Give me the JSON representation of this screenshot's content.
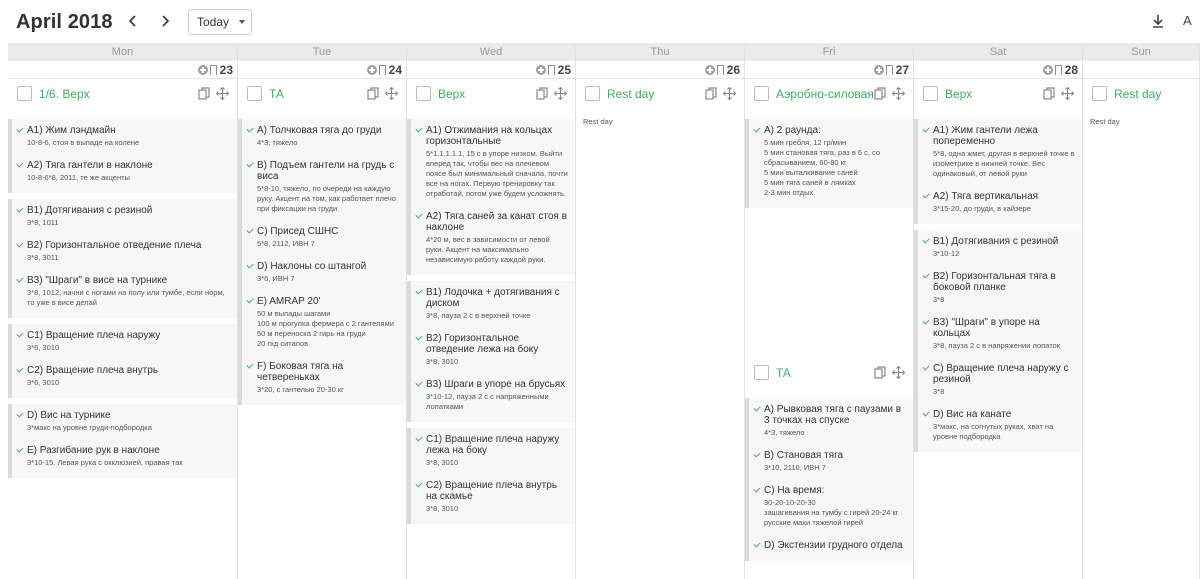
{
  "header": {
    "month_title": "April 2018",
    "today_label": "Today",
    "font_label": "A"
  },
  "days": [
    {
      "name": "Mon",
      "date": "23",
      "workout": {
        "title": "1/6. Верх",
        "blocks": [
          [
            {
              "name": "A1) Жим лэндмайн",
              "desc": "10-8-6, стоя в выпаде на колене"
            },
            {
              "name": "A2) Тяга гантели в наклоне",
              "desc": "10-8-6*8, 2011, те же акценты"
            }
          ],
          [
            {
              "name": "B1) Дотягивания с резиной",
              "desc": "3*8, 1011"
            },
            {
              "name": "B2) Горизонтальное отведение плеча",
              "desc": "3*8, 3011"
            },
            {
              "name": "B3) \"Шраги\" в висе на турнике",
              "desc": "3*8, 1012, начни с ногами на полу или тумбе, если норм, то уже в висе делай"
            }
          ],
          [
            {
              "name": "C1) Вращение плеча наружу",
              "desc": "3*6, 3010"
            },
            {
              "name": "C2) Вращение плеча внутрь",
              "desc": "3*6, 3010"
            }
          ],
          [
            {
              "name": "D) Вис на турнике",
              "desc": "3*макс на уровне груди-подбородка"
            },
            {
              "name": "E) Разгибание рук в наклоне",
              "desc": "3*10-15. Левая рука с окклюзией, правая так"
            }
          ]
        ]
      }
    },
    {
      "name": "Tue",
      "date": "24",
      "workout": {
        "title": "ТА",
        "blocks": [
          [
            {
              "name": "A) Толчковая тяга до груди",
              "desc": "4*3, тяжело"
            },
            {
              "name": "B) Подъем гантели на грудь с виса",
              "desc": "5*8-10, тяжело, по очереди на каждую руку. Акцент на том, как работает плечо при фиксации на груди"
            },
            {
              "name": "C) Присед СШНС",
              "desc": "5*8, 2112, ИВН 7"
            },
            {
              "name": "D) Наклоны со штангой",
              "desc": "3*6, ИВН 7"
            },
            {
              "name": "E) AMRAP 20'",
              "desc": "50 м выпады шагами\n100 м прогулка фермера с 2 гантелями\n50 м переноска 2 гирь на груди\n20 гхд ситапов"
            },
            {
              "name": "F) Боковая тяга на четвереньках",
              "desc": "3*20, с гантелью 20-30 кг"
            }
          ]
        ]
      }
    },
    {
      "name": "Wed",
      "date": "25",
      "workout": {
        "title": "Верх",
        "blocks": [
          [
            {
              "name": "A1) Отжимания на кольцах горизонтальные",
              "desc": "5*1.1.1.1.1, 15 с в упоре низком. Выйти вперед так, чтобы вес на плечевом поясе был минимальный сначала, почти все на ногах. Первую тренировку так отработай, потом уже будем усложнять."
            },
            {
              "name": "A2) Тяга саней за канат стоя в наклоне",
              "desc": "4*20 м, вес в зависимости от левой руки. Акцент на максимально независимую работу каждой руки."
            }
          ],
          [
            {
              "name": "B1) Лодочка + дотягивания с диском",
              "desc": "3*8, пауза 2 с в верхней точке"
            },
            {
              "name": "B2) Горизонтальное отведение лежа на боку",
              "desc": "3*8, 3010"
            },
            {
              "name": "B3) Шраги в упоре на брусьях",
              "desc": "3*10-12, пауза 2 с с напряженными лопатками"
            }
          ],
          [
            {
              "name": "C1) Вращение плеча наружу лежа на боку",
              "desc": "3*8, 3010"
            },
            {
              "name": "C2) Вращение плеча внутрь на скамье",
              "desc": "3*8, 3010"
            }
          ]
        ]
      }
    },
    {
      "name": "Thu",
      "date": "26",
      "workout": {
        "title": "Rest day",
        "rest_text": "Rest day",
        "blocks": []
      }
    },
    {
      "name": "Fri",
      "date": "27",
      "workout": {
        "title": "Аэробно-силовая",
        "blocks": [
          [
            {
              "name": "A) 2 раунда:",
              "desc": "5 мин гребля, 12 гр/мин\n5 мин становая тяга, раз в 6 с, со сбрасыванием, 60-80 кг\n5 мин выталкивание саней\n5 мин тяга саней в лямках\n2-3 мин отдых"
            }
          ]
        ]
      },
      "workout2": {
        "title": "ТА",
        "blocks": [
          [
            {
              "name": "A) Рывковая тяга с паузами в 3 точках на спуске",
              "desc": "4*3, тяжело"
            },
            {
              "name": "B) Становая тяга",
              "desc": "3*10, 2110, ИВН 7"
            },
            {
              "name": "C) На время:",
              "desc": "30-20-10-20-30\nзашагивания на тумбу с гирей 20-24 кг\nрусские махи тяжелой гирей"
            },
            {
              "name": "D) Экстензии грудного отдела",
              "desc": ""
            }
          ]
        ]
      }
    },
    {
      "name": "Sat",
      "date": "28",
      "workout": {
        "title": "Верх",
        "blocks": [
          [
            {
              "name": "A1) Жим гантели лежа попеременно",
              "desc": "5*8, одна жмет, другая в верхней точке в изометрике в нижней точке. Вес одинаковый, от левой руки"
            },
            {
              "name": "A2) Тяга вертикальная",
              "desc": "3*15-20, до груди, в кайзере"
            }
          ],
          [
            {
              "name": "B1) Дотягивания с резиной",
              "desc": "3*10-12"
            },
            {
              "name": "B2) Горизонтальная тяга в боковой планке",
              "desc": "3*8"
            },
            {
              "name": "B3) \"Шраги\" в упоре на кольцах",
              "desc": "3*8, пауза 2 с в напряжении лопаток"
            },
            {
              "name": "C) Вращение плеча наружу с резиной",
              "desc": "3*8"
            },
            {
              "name": "D) Вис на канате",
              "desc": "3*макс, на согнутых руках, хват на уровне подбородка"
            }
          ]
        ]
      }
    },
    {
      "name": "Sun",
      "date": "",
      "workout": {
        "title": "Rest day",
        "rest_text": "Rest day",
        "blocks": []
      }
    }
  ]
}
